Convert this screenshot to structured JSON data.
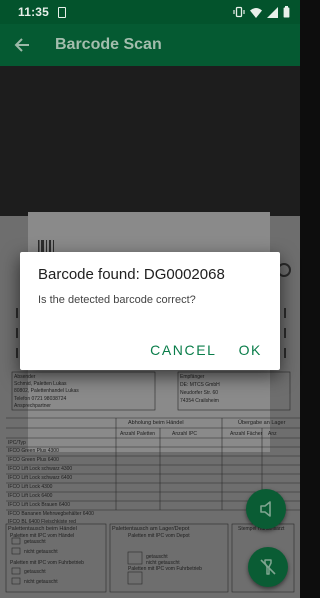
{
  "status_bar": {
    "time": "11:35"
  },
  "app_bar": {
    "title": "Barcode Scan"
  },
  "dialog": {
    "title": "Barcode found: DG0002068",
    "message": "Is the detected barcode correct?",
    "cancel_label": "CANCEL",
    "ok_label": "OK"
  },
  "document": {
    "sender_label": "Absender",
    "sender_line1": "Schmid, Paletten Lukas",
    "sender_line2": "80802, Palettenhandel Lukas",
    "sender_phone": "Telefon 0721 98038724",
    "sender_contact": "Ansprechpartner",
    "receiver_label": "Empfänger",
    "receiver_line1": "DE: MTCS GmbH",
    "receiver_line2": "Neudorfer Str. 60",
    "receiver_line3": "74354 Crailsheim",
    "col_pickup": "Abholung beim Händel",
    "col_handover": "Übergabe an Lager",
    "sub_count_pallets": "Anzahl Paletten",
    "sub_count_ipc": "Anzahl IPC",
    "sub_count_boxes": "Anzahl Fächer",
    "sub_count2": "Anz",
    "type_header": "IPC/Typ",
    "rows": [
      "IFCO Green Plus 4300",
      "IFCO Green Plus 6400",
      "IFCO Lift Lock schwarz 4300",
      "IFCO Lift Lock schwarz 6400",
      "IFCO Lift Lock 4300",
      "IFCO Lift Lock 6400",
      "IFCO Lift Lock Brauen 6400",
      "IFCO Bananen Mehrwegbehälter 6400",
      "IFCO BL 6400 Fleischkiste red"
    ],
    "section_exchange": "Palettentausch beim Händel",
    "section_exchange2": "Palettentausch am Lager/Depot",
    "option_pallets_handel": "Paletten mit IPC vom Händel",
    "option_pallets_depot": "Paletten mit IPC vom Depot",
    "option_exchanged": "getauscht",
    "option_not_exchanged": "nicht getauscht",
    "option_footer": "Paletten mit IPC vom Fuhrbetrieb",
    "option_footer2": "Paletten mit IPC vom Fuhrbetrieb",
    "signature": "Stempel Händelsarzt"
  }
}
